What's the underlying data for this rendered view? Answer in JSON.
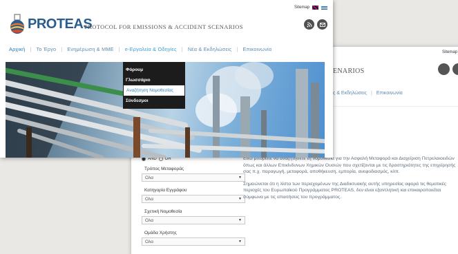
{
  "back_window": {
    "sitemap": "Sitemap",
    "title": "ENARIOS",
    "nav": [
      "ς & Εκδηλώσεις",
      "Επικοινωνία"
    ],
    "filters": {
      "radio_and": "AND",
      "radio_or": "OR",
      "groups": [
        {
          "label": "Τρόπος Μεταφοράς",
          "value": "Ολα"
        },
        {
          "label": "Κατηγορία Εγγράφου",
          "value": "Ολα"
        },
        {
          "label": "Σχετική Νομοθεσία",
          "value": "Ολα"
        },
        {
          "label": "Ομάδα Χρήστης",
          "value": "Ολα"
        }
      ]
    },
    "paragraph1": "Εδώ μπορείτε να αναζητήσετε τη νομοθεσία για την Ασφαλή Μεταφορά και Διαχείριση Πετρελαιοειδών όπως και άλλων Επικίνδυνων Χημικών Ουσιών που σχετίζονται με τις δραστηριότητες της επιχείρησής σας π.χ. παραγωγή, μεταφορά, αποθήκευση, εμπορία, ανεφοδιασμός, κλπ.",
    "paragraph2": "Σημειώνεται ότι η λίστα των περιεχομένων της Διαδικτυακής αυτής υπηρεσίας αφορά τις θεματικές περιοχές του Ευρωπαϊκού Προγράμματος PROTEAS, δεν είναι εξαντλητική και επικαιροποιείται σύμφωνα με τις απαιτήσεις του προγράμματος."
  },
  "front_window": {
    "sitemap": "Sitemap",
    "logo_text": "PROTEAS",
    "protocol_title": "PROTOCOL FOR EMISSIONS & ACCIDENT SCENARIOS",
    "nav": [
      {
        "label": "Αρχική",
        "state": "active"
      },
      {
        "label": "Το Έργο",
        "state": ""
      },
      {
        "label": "Ενημέρωση & ΜΜΕ",
        "state": ""
      },
      {
        "label": "e-Εργαλεία & Οδηγίες",
        "state": "open"
      },
      {
        "label": "Νέα & Εκδηλώσεις",
        "state": ""
      },
      {
        "label": "Επικοινωνία",
        "state": ""
      }
    ],
    "dropdown": [
      "Φόρουμ",
      "Γλωσσάριο",
      "Αναζήτηση Νομοθεσίας",
      "Σύνδεσμοι"
    ],
    "dropdown_highlighted": "Αναζήτηση Νομοθεσίας",
    "icons": [
      "rss-icon",
      "email-icon"
    ]
  },
  "colors": {
    "nav_link": "#5b8ab0",
    "active": "#1f77b4",
    "dropdown_bg": "#1c1c1c",
    "logo": "#2a5d8f"
  }
}
